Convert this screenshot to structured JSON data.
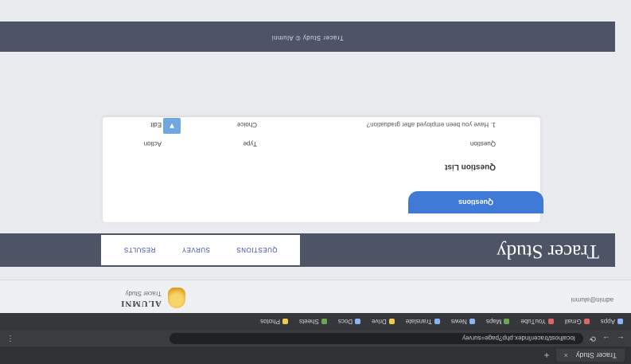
{
  "browser": {
    "tab_title": "Tracer Study",
    "tab_close": "×",
    "new_tab": "+",
    "nav": {
      "back": "←",
      "forward": "→",
      "reload": "⟳"
    },
    "address": "localhost/tracer/index.php?page=survey",
    "bookmarks": [
      "Apps",
      "Gmail",
      "YouTube",
      "Maps",
      "News",
      "Translate",
      "Drive",
      "Docs",
      "Sheets",
      "Photos"
    ],
    "menu": "⋮"
  },
  "page": {
    "logo_title": "ALUMNI",
    "logo_subtitle": "Tracer Study",
    "top_right_text": "admin@alumni",
    "site_title": "Tracer Study",
    "menu": [
      "Questions",
      "Survey",
      "Results"
    ],
    "tab_label": "Questions",
    "card_title": "Question List",
    "table": {
      "headers": [
        "Question",
        "Type",
        "Action"
      ],
      "rows": [
        [
          "1. Have you been employed after graduation?",
          "Choice",
          "Edit"
        ]
      ]
    },
    "icon_button": "▼",
    "footer": "Tracer Study © Alumni"
  }
}
